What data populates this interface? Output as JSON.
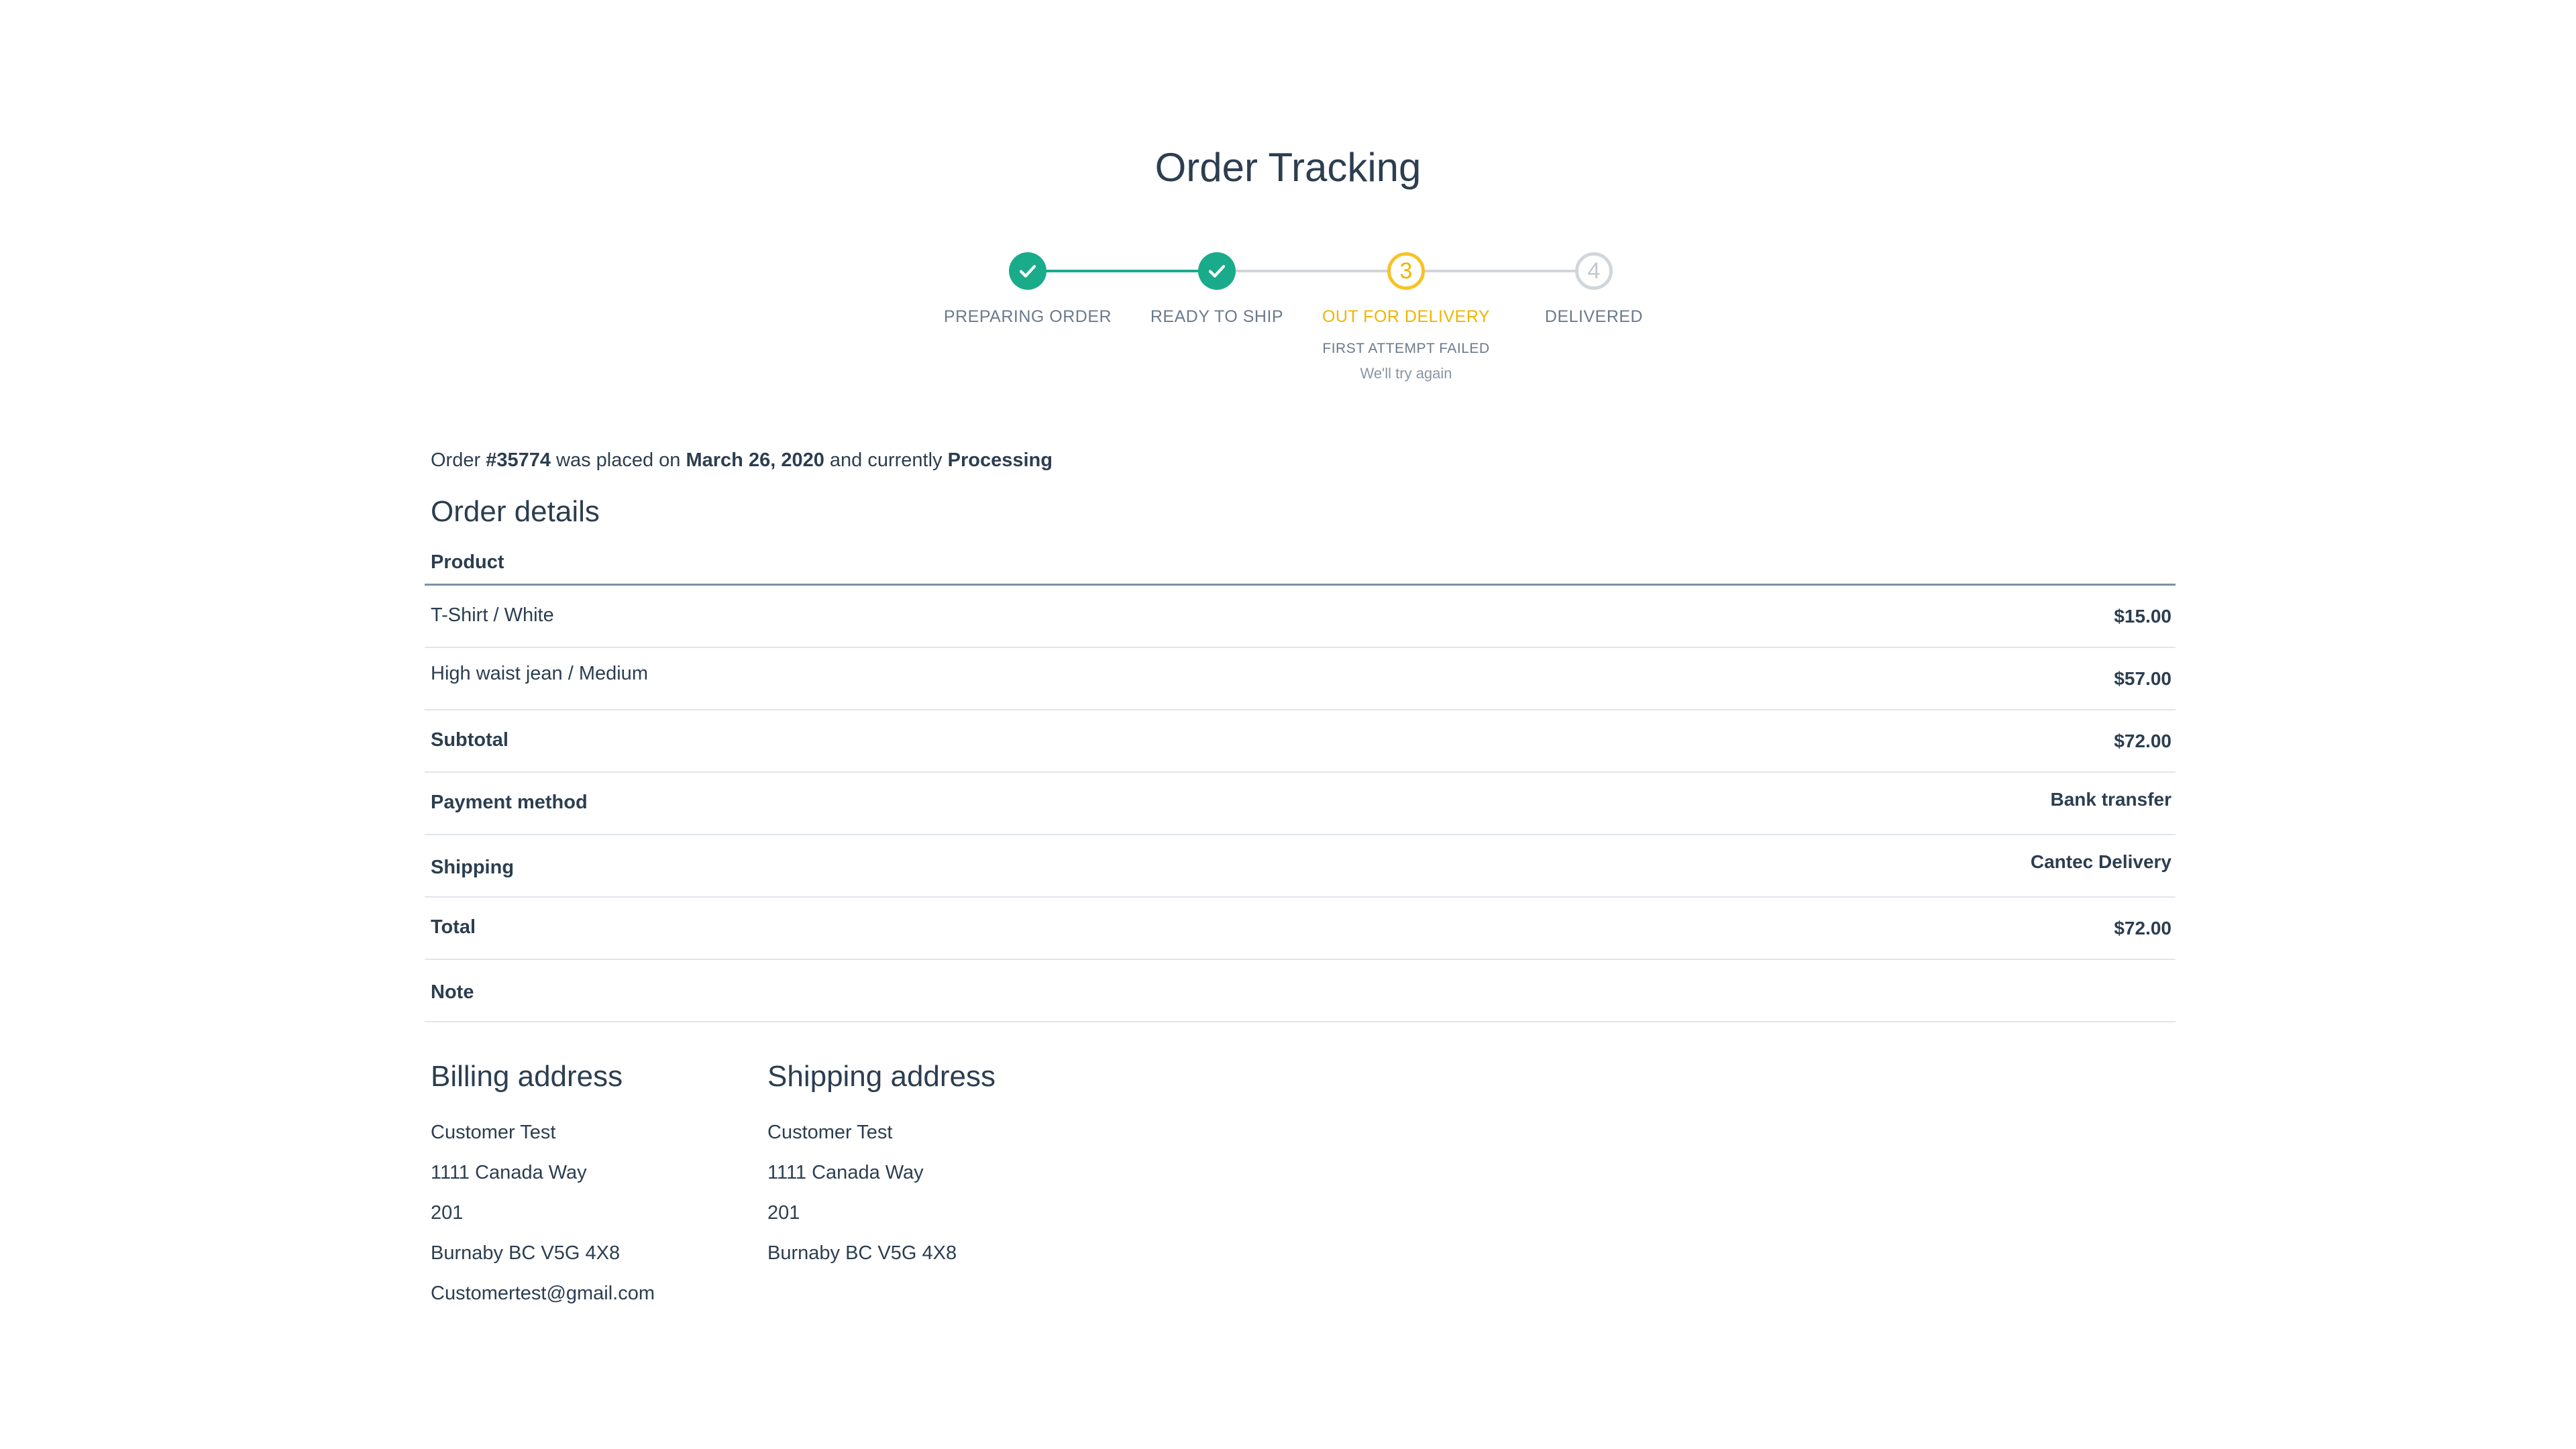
{
  "title": "Order Tracking",
  "colors": {
    "done": "#1aab8a",
    "current": "#f7c325",
    "todo": "#d1d6db",
    "text": "#2c3e50"
  },
  "stepper": {
    "steps": [
      {
        "label": "PREPARING ORDER",
        "status": "done",
        "icon": "check-icon"
      },
      {
        "label": "READY TO SHIP",
        "status": "done",
        "icon": "check-icon"
      },
      {
        "label": "OUT FOR DELIVERY",
        "status": "current",
        "number": "3",
        "note": "FIRST ATTEMPT FAILED",
        "subnote": "We'll try again"
      },
      {
        "label": "DELIVERED",
        "status": "todo",
        "number": "4"
      }
    ]
  },
  "summary": {
    "prefix": "Order ",
    "order_number": "#35774",
    "middle": " was placed on ",
    "date": "March 26, 2020",
    "middle2": " and currently ",
    "status": "Processing"
  },
  "order_details": {
    "title": "Order details",
    "column_header": "Product",
    "rows": [
      {
        "label": "T-Shirt / White",
        "value": "$15.00",
        "strong": false
      },
      {
        "label": "High waist jean / Medium",
        "value": "$57.00",
        "strong": false
      },
      {
        "label": "Subtotal",
        "value": "$72.00",
        "strong": true
      },
      {
        "label": "Payment method",
        "value": "Bank transfer",
        "strong": true
      },
      {
        "label": "Shipping",
        "value": "Cantec Delivery",
        "strong": true
      },
      {
        "label": "Total",
        "value": "$72.00",
        "strong": true
      },
      {
        "label": "Note",
        "value": "",
        "strong": true
      }
    ]
  },
  "billing": {
    "title": "Billing address",
    "lines": [
      "Customer Test",
      "1111 Canada Way",
      "201",
      "Burnaby BC V5G 4X8",
      "Customertest@gmail.com"
    ]
  },
  "shipping": {
    "title": "Shipping address",
    "lines": [
      "Customer Test",
      "1111 Canada Way",
      "201",
      "Burnaby BC V5G 4X8"
    ]
  }
}
